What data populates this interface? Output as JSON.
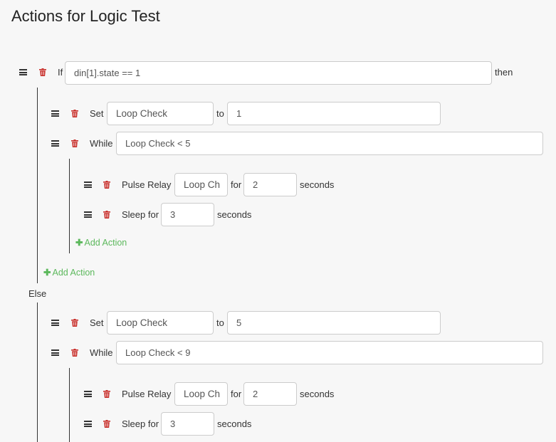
{
  "page": {
    "title": "Actions for Logic Test"
  },
  "icons": {
    "drag": "drag-handle-icon",
    "delete": "trash-icon",
    "add": "plus-icon"
  },
  "colors": {
    "delete": "#c9302c",
    "add": "#5cb85c"
  },
  "if_block": {
    "keyword": "If",
    "condition": "din[1].state == 1",
    "then": "then"
  },
  "then_branch": {
    "set": {
      "label": "Set",
      "variable": "Loop Check",
      "to": "to",
      "value": "1"
    },
    "while": {
      "label": "While",
      "condition": "Loop Check < 5",
      "pulse": {
        "label": "Pulse Relay",
        "relay": "Loop Ch",
        "for": "for",
        "value": "2",
        "unit": "seconds"
      },
      "sleep": {
        "label": "Sleep for",
        "value": "3",
        "unit": "seconds"
      },
      "add_action": "Add Action"
    },
    "add_action": "Add Action"
  },
  "else_branch": {
    "keyword": "Else",
    "set": {
      "label": "Set",
      "variable": "Loop Check",
      "to": "to",
      "value": "5"
    },
    "while": {
      "label": "While",
      "condition": "Loop Check < 9",
      "pulse": {
        "label": "Pulse Relay",
        "relay": "Loop Ch",
        "for": "for",
        "value": "2",
        "unit": "seconds"
      },
      "sleep": {
        "label": "Sleep for",
        "value": "3",
        "unit": "seconds"
      }
    }
  }
}
